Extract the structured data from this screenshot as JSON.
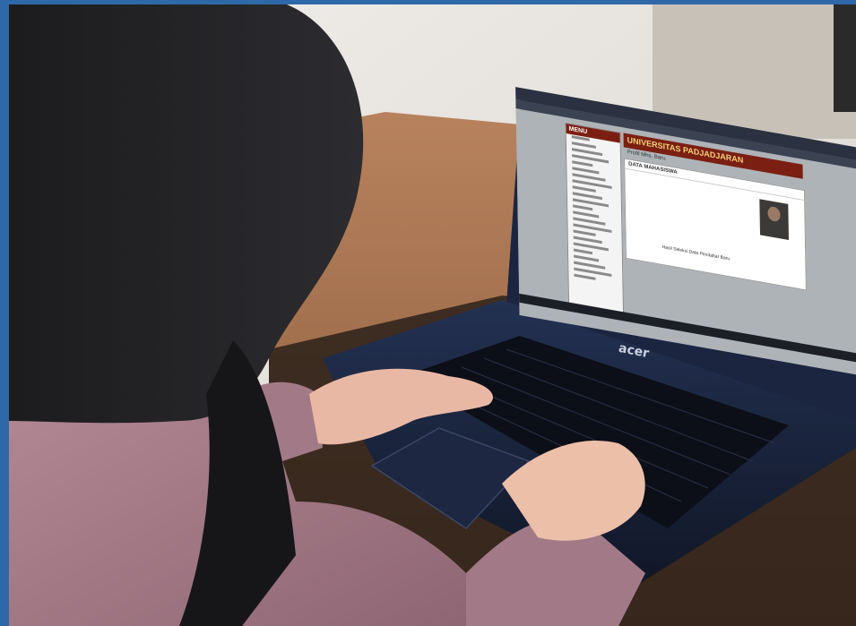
{
  "laptop": {
    "brand": "acer"
  },
  "screen": {
    "menu_label": "MENU",
    "site_title": "UNIVERSITAS PADJADJARAN",
    "section_label": "Profil Mhs. Baru",
    "card_header": "DATA MAHASISWA",
    "footer_link": "Hasil Seleksi Data Pendaftar Baru",
    "sidebar_count": 23
  },
  "colors": {
    "frame": "#2f68a8",
    "university_red": "#7b1f12",
    "screen_bg": "#aeb3b8",
    "laptop_body": "#1c2640"
  }
}
